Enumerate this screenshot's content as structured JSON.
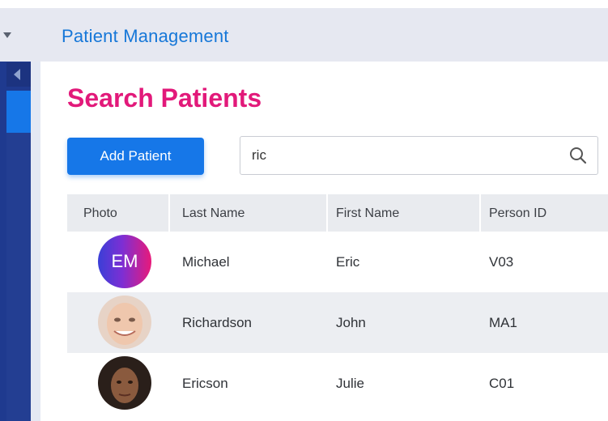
{
  "header": {
    "title": "Patient Management"
  },
  "page": {
    "title": "Search Patients"
  },
  "toolbar": {
    "add_label": "Add Patient"
  },
  "search": {
    "value": "ric"
  },
  "table": {
    "columns": [
      "Photo",
      "Last Name",
      "First Name",
      "Person ID"
    ],
    "rows": [
      {
        "avatar_initials": "EM",
        "last_name": "Michael",
        "first_name": "Eric",
        "person_id": "V03"
      },
      {
        "avatar_initials": "",
        "last_name": "Richardson",
        "first_name": "John",
        "person_id": "MA1"
      },
      {
        "avatar_initials": "",
        "last_name": "Ericson",
        "first_name": "Julie",
        "person_id": "C01"
      }
    ]
  },
  "colors": {
    "accent": "#1677e8",
    "title": "#e2197a",
    "sidebar": "#1f3a8f"
  },
  "icons": [
    "caret-down-icon",
    "collapse-arrow-icon",
    "search-icon"
  ]
}
